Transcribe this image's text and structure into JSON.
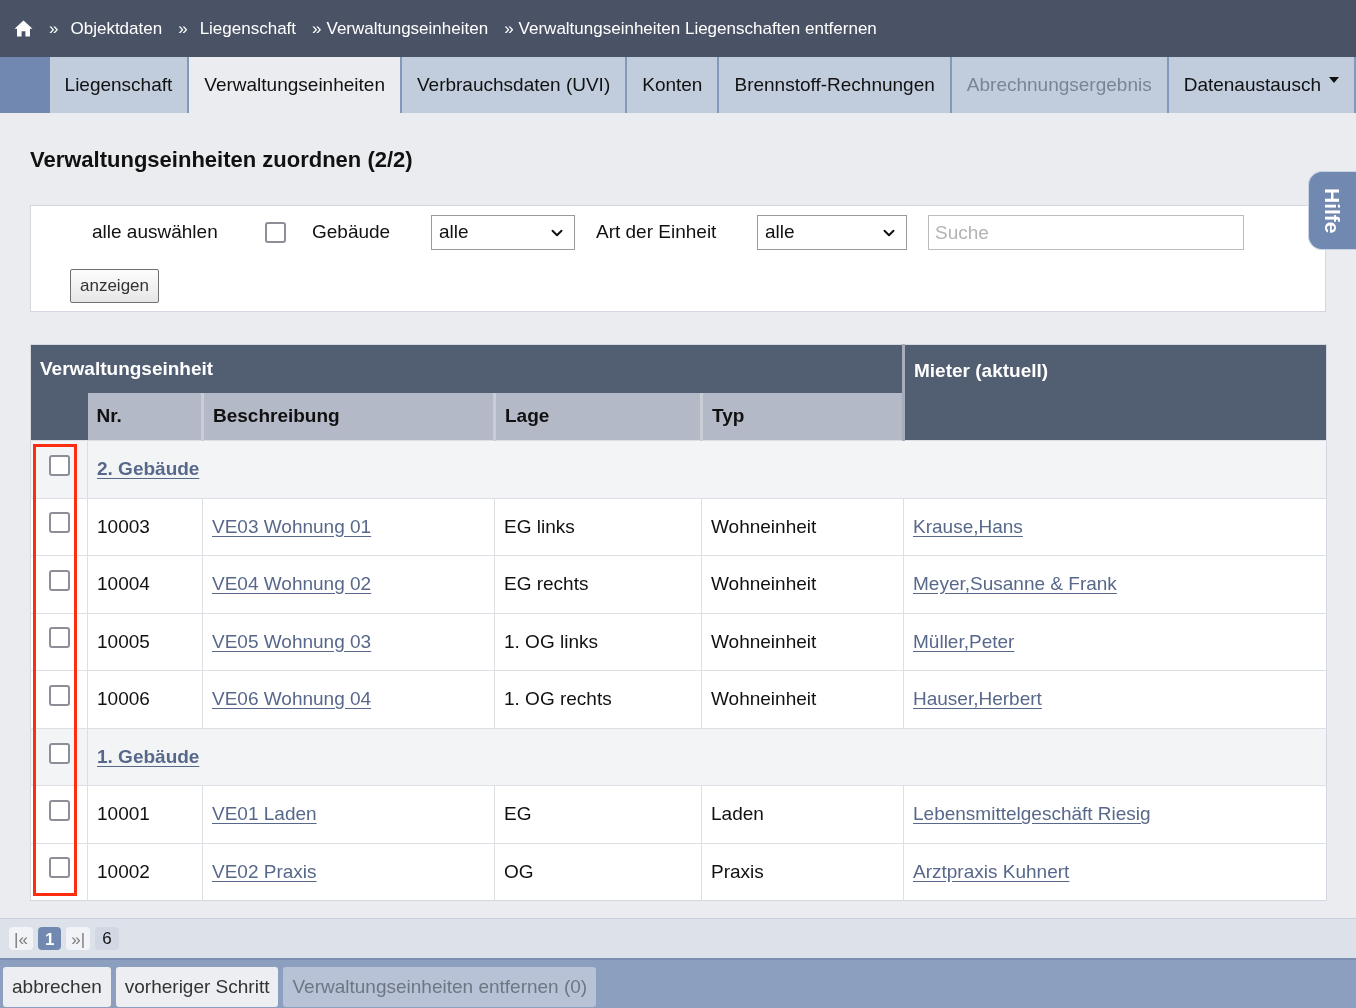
{
  "breadcrumb": [
    {
      "kind": "separated",
      "separator": "»",
      "label": "Objektdaten"
    },
    {
      "kind": "separated",
      "separator": "»",
      "label": "Liegenschaft"
    },
    {
      "kind": "inline",
      "separator": "»",
      "label": "Verwaltungseinheiten"
    },
    {
      "kind": "inline",
      "separator": "»",
      "label": "Verwaltungseinheiten Liegenschaften entfernen"
    }
  ],
  "tabs": [
    {
      "label": "Liegenschaft",
      "selected": false,
      "disabled": false,
      "dropdown": false
    },
    {
      "label": "Verwaltungseinheiten",
      "selected": true,
      "disabled": false,
      "dropdown": false
    },
    {
      "label": "Verbrauchsdaten (UVI)",
      "selected": false,
      "disabled": false,
      "dropdown": false
    },
    {
      "label": "Konten",
      "selected": false,
      "disabled": false,
      "dropdown": false
    },
    {
      "label": "Brennstoff-Rechnungen",
      "selected": false,
      "disabled": false,
      "dropdown": false
    },
    {
      "label": "Abrechnungsergebnis",
      "selected": false,
      "disabled": true,
      "dropdown": false
    },
    {
      "label": "Datenaustausch",
      "selected": false,
      "disabled": false,
      "dropdown": true
    }
  ],
  "help_tab": {
    "label": "Hilfe"
  },
  "title": "Verwaltungseinheiten zuordnen (2/2)",
  "filter": {
    "select_all": {
      "label": "alle auswählen",
      "checked": false
    },
    "building": {
      "label": "Gebäude",
      "value": "alle"
    },
    "unit_type": {
      "label": "Art der Einheit",
      "value": "alle"
    },
    "search": {
      "placeholder": "Suche"
    },
    "submit": "anzeigen"
  },
  "table": {
    "group_header": "Verwaltungseinheit",
    "columns": [
      "Nr.",
      "Beschreibung",
      "Lage",
      "Typ"
    ],
    "tenant_header": "Mieter (aktuell)",
    "groups": [
      {
        "label": "2. Gebäude",
        "checked": false,
        "rows": [
          {
            "nr": "10003",
            "description": "VE03 Wohnung 01",
            "location": "EG links",
            "type": "Wohneinheit",
            "tenant": "Krause,Hans",
            "checked": false
          },
          {
            "nr": "10004",
            "description": "VE04 Wohnung 02",
            "location": "EG rechts",
            "type": "Wohneinheit",
            "tenant": "Meyer,Susanne & Frank",
            "checked": false
          },
          {
            "nr": "10005",
            "description": "VE05 Wohnung 03",
            "location": "1. OG links",
            "type": "Wohneinheit",
            "tenant": "Müller,Peter",
            "checked": false
          },
          {
            "nr": "10006",
            "description": "VE06 Wohnung 04",
            "location": "1. OG rechts",
            "type": "Wohneinheit",
            "tenant": "Hauser,Herbert",
            "checked": false
          }
        ]
      },
      {
        "label": "1. Gebäude",
        "checked": false,
        "rows": [
          {
            "nr": "10001",
            "description": "VE01 Laden",
            "location": "EG",
            "type": "Laden",
            "tenant": "Lebensmittelgeschäft Riesig",
            "checked": false
          },
          {
            "nr": "10002",
            "description": "VE02 Praxis",
            "location": "OG",
            "type": "Praxis",
            "tenant": "Arztpraxis Kuhnert",
            "checked": false
          }
        ]
      }
    ]
  },
  "pagination": {
    "first": "|«",
    "pages": [
      {
        "label": "1",
        "selected": true
      }
    ],
    "last": "»|",
    "total": "6"
  },
  "footer_buttons": [
    {
      "label": "abbrechen",
      "disabled": false
    },
    {
      "label": "vorheriger Schritt",
      "disabled": false
    },
    {
      "label": "Verwaltungseinheiten entfernen (0)",
      "disabled": true
    }
  ]
}
